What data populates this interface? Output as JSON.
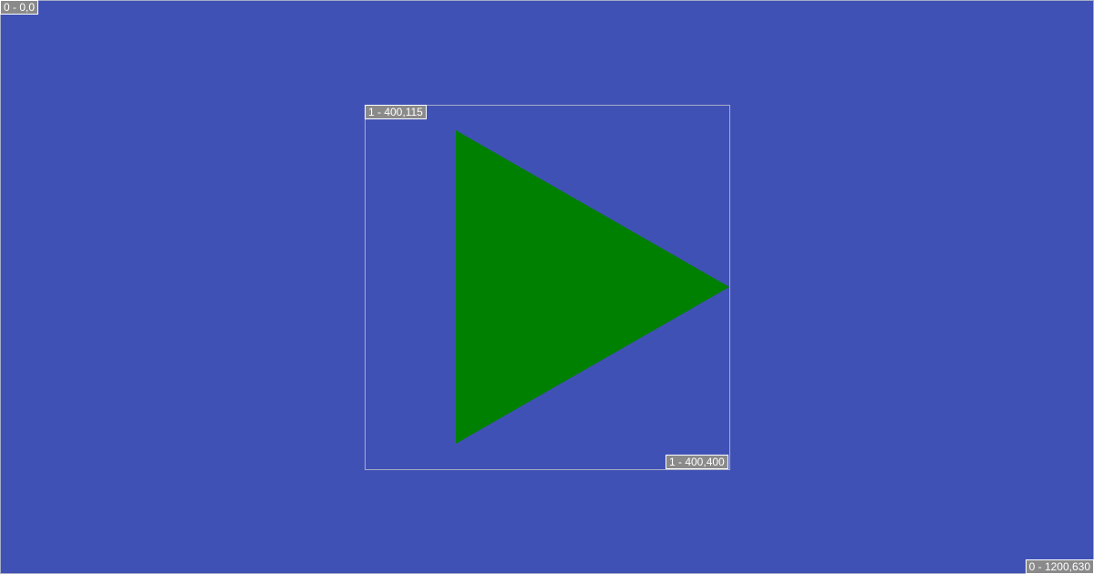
{
  "colors": {
    "background": "#4051b5",
    "shape_fill": "#008000",
    "frame_border": "#a8acc4",
    "label_bg": "#8a8a8a",
    "label_text": "#ffffff"
  },
  "labels": {
    "outer_start": "0 - 0,0",
    "outer_end": "0 - 1200,630",
    "inner_start": "1 - 400,115",
    "inner_end": "1 - 400,400"
  },
  "shape": {
    "icon": "play-triangle-icon"
  }
}
